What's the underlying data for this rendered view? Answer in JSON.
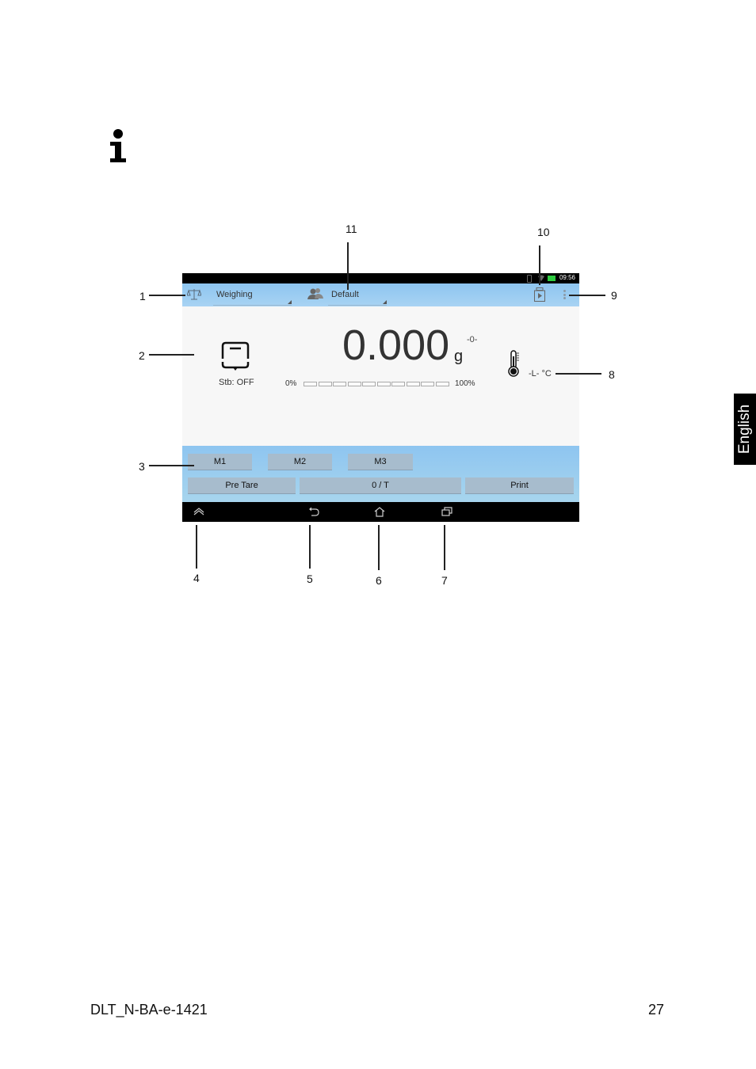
{
  "page": {
    "info_icon": "info-icon",
    "language_tab": "English",
    "footer": {
      "document_id": "DLT_N-BA-e-1421",
      "page_number": "27"
    }
  },
  "screen": {
    "status_bar": {
      "time": "09:56",
      "icons": [
        "bluetooth-icon",
        "wifi-icon",
        "battery-icon"
      ]
    },
    "top_bar": {
      "mode_icon": "balance-scale-icon",
      "mode_dropdown": "Weighing",
      "user_icon": "users-icon",
      "user_dropdown": "Default",
      "app_icon": "print-data-icon",
      "menu_icon": "overflow-menu-icon"
    },
    "display": {
      "stability_icon": "stability-icon",
      "stability_label": "Stb: OFF",
      "weight": "0.000",
      "unit": "g",
      "zero_indicator": "-0-",
      "capacity_min_label": "0%",
      "capacity_max_label": "100%",
      "capacity_fraction": 0.0,
      "capacity_segments": 10,
      "thermometer_icon": "thermometer-icon",
      "temperature_label": "-L- °C"
    },
    "memory_buttons": [
      "M1",
      "M2",
      "M3"
    ],
    "function_buttons": {
      "pre_tare": "Pre Tare",
      "zero_tare": "0 / T",
      "print": "Print"
    },
    "nav_bar": [
      "hide-bar-icon",
      "back-icon",
      "home-icon",
      "recent-apps-icon"
    ]
  },
  "callouts": [
    "1",
    "2",
    "3",
    "4",
    "5",
    "6",
    "7",
    "8",
    "9",
    "10",
    "11"
  ],
  "colors": {
    "screen_blue": "#8ec5f0",
    "button_gray": "#a7bccd",
    "battery_green": "#2ecc40"
  }
}
